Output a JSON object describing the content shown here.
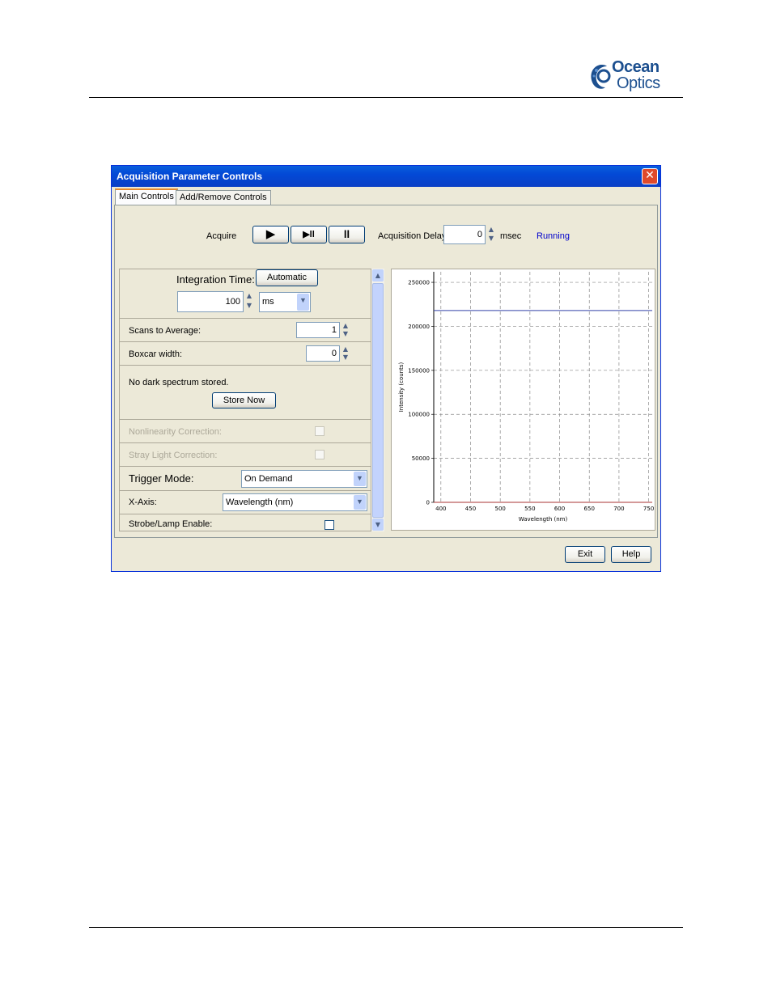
{
  "logo": {
    "line1": "Ocean",
    "line2": "Optics"
  },
  "window": {
    "title": "Acquisition Parameter Controls",
    "close_glyph": "✕"
  },
  "tabs": [
    {
      "label": "Main Controls",
      "active": true
    },
    {
      "label": "Add/Remove Controls",
      "active": false
    }
  ],
  "acquire": {
    "label": "Acquire",
    "play_glyph": "▶",
    "step_glyph": "▶ll",
    "pause_glyph": "ll",
    "delay_label": "Acquisition Delay",
    "delay_value": "0",
    "delay_unit": "msec",
    "status": "Running",
    "status_color": "#0000cc"
  },
  "controls": {
    "integration_label": "Integration Time:",
    "automatic_button": "Automatic",
    "integration_value": "100",
    "integration_unit": "ms",
    "scans_label": "Scans to Average:",
    "scans_value": "1",
    "boxcar_label": "Boxcar width:",
    "boxcar_value": "0",
    "dark_text": "No dark spectrum stored.",
    "store_now": "Store Now",
    "nonlinearity_label": "Nonlinearity Correction:",
    "stray_light_label": "Stray Light Correction:",
    "trigger_label": "Trigger Mode:",
    "trigger_value": "On Demand",
    "xaxis_label": "X-Axis:",
    "xaxis_value": "Wavelength (nm)",
    "strobe_label": "Strobe/Lamp Enable:"
  },
  "buttons": {
    "exit": "Exit",
    "help": "Help"
  },
  "chart_data": {
    "type": "line",
    "xlabel": "Wavelength (nm)",
    "ylabel": "Intensity (counts)",
    "xlim": [
      388,
      756
    ],
    "ylim": [
      0,
      262000
    ],
    "xticks": [
      400,
      450,
      500,
      550,
      600,
      650,
      700,
      750
    ],
    "yticks": [
      0,
      50000,
      100000,
      150000,
      200000,
      250000
    ],
    "grid": true,
    "series": [
      {
        "color": "#3340a8",
        "x": [
          388,
          756
        ],
        "y": [
          218000,
          218000
        ]
      },
      {
        "color": "#a83333",
        "x": [
          388,
          756
        ],
        "y": [
          0,
          0
        ]
      }
    ]
  }
}
